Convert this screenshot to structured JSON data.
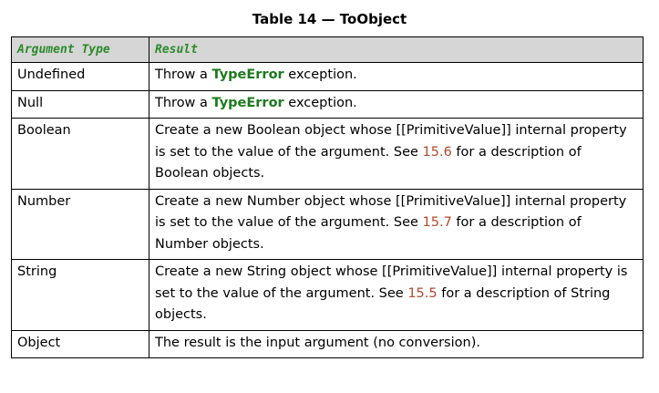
{
  "caption": "Table 14 — ToObject",
  "headers": {
    "argument_type": "Argument Type",
    "result": "Result"
  },
  "rows": [
    {
      "type": "Undefined",
      "pre": "Throw a ",
      "code": "TypeError",
      "post": " exception."
    },
    {
      "type": "Null",
      "pre": "Throw a ",
      "code": "TypeError",
      "post": " exception."
    },
    {
      "type": "Boolean",
      "pre": "Create a new Boolean object whose [[PrimitiveValue]] internal property is set to the value of the argument. See ",
      "ref": "15.6",
      "post": " for a description of Boolean objects."
    },
    {
      "type": "Number",
      "pre": "Create a new Number object whose [[PrimitiveValue]] internal property is set to the value of the argument. See ",
      "ref": "15.7",
      "post": " for a description of Number objects."
    },
    {
      "type": "String",
      "pre": "Create a new String object whose [[PrimitiveValue]] internal property is set to the value of the argument. See ",
      "ref": "15.5",
      "post": " for a description of String objects."
    },
    {
      "type": "Object",
      "pre": "The result is the input argument (no conversion)."
    }
  ]
}
